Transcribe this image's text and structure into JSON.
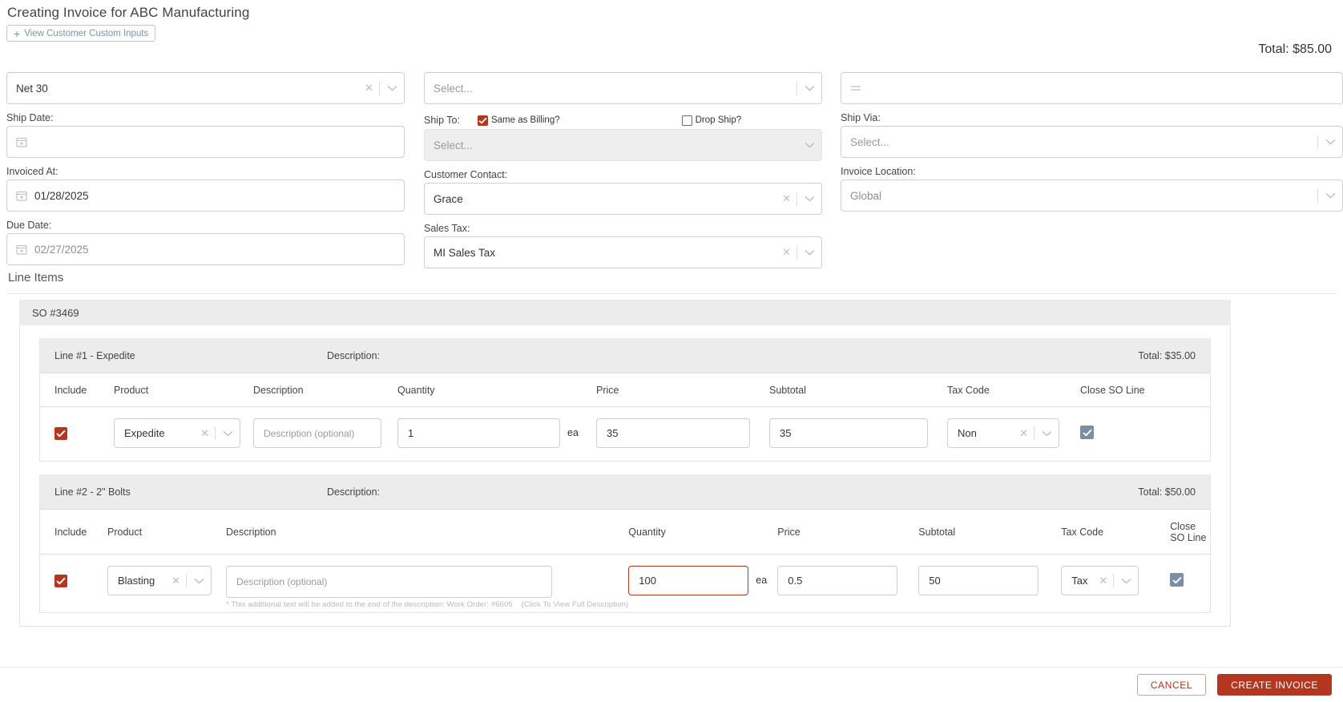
{
  "header": {
    "title": "Creating Invoice for ABC Manufacturing",
    "custom_inputs_button": "View Customer Custom Inputs",
    "plus_icon": "+",
    "total": "Total: $85.00"
  },
  "colors": {
    "accent_red": "#b5361f",
    "checkbox_blue": "#7a8fa6",
    "link_blue": "#7a93ad",
    "header_gray": "#ececec"
  },
  "form": {
    "terms": {
      "value": "Net 30",
      "placeholder": "Select..."
    },
    "ship_date": {
      "label": "Ship Date:",
      "value": "",
      "placeholder": ""
    },
    "invoiced_at": {
      "label": "Invoiced At:",
      "value": "01/28/2025"
    },
    "due_date": {
      "label": "Due Date:",
      "value": "02/27/2025"
    },
    "billing_select": {
      "placeholder": "Select..."
    },
    "ship_to": {
      "label": "Ship To:",
      "same_as_billing_label": "Same as Billing?",
      "same_as_billing_checked": true,
      "drop_ship_label": "Drop Ship?",
      "drop_ship_checked": false,
      "placeholder": "Select..."
    },
    "customer_contact": {
      "label": "Customer Contact:",
      "value": "Grace"
    },
    "sales_tax": {
      "label": "Sales Tax:",
      "value": "MI Sales Tax"
    },
    "notes": {
      "placeholder": ""
    },
    "ship_via": {
      "label": "Ship Via:",
      "placeholder": "Select..."
    },
    "invoice_location": {
      "label": "Invoice Location:",
      "value": "Global"
    }
  },
  "line_items": {
    "section_title": "Line Items",
    "so_label": "SO #3469",
    "columns": [
      "Include",
      "Product",
      "Description",
      "Quantity",
      "Price",
      "Subtotal",
      "Tax Code",
      "Close SO Line"
    ],
    "description_head_label": "Description:",
    "lines": [
      {
        "name": "Line #1 - Expedite",
        "description_label": "Description:",
        "description_value": "",
        "total": "Total: $35.00",
        "include_checked": true,
        "product": "Expedite",
        "description_placeholder": "Description (optional)",
        "description": "",
        "quantity": "1",
        "unit": "ea",
        "price": "35",
        "subtotal": "35",
        "tax_code": "Non",
        "close_so_line_checked": true,
        "quantity_focused": false,
        "note": ""
      },
      {
        "name": "Line #2 - 2\" Bolts",
        "description_label": "Description:",
        "description_value": "",
        "total": "Total: $50.00",
        "include_checked": true,
        "product": "Blasting",
        "description_placeholder": "Description (optional)",
        "description": "",
        "quantity": "100",
        "unit": "ea",
        "price": "0.5",
        "subtotal": "50",
        "tax_code": "Tax",
        "close_so_line_checked": true,
        "quantity_focused": true,
        "note": "* This additional text will be added to the end of the description: Work Order: #6605",
        "note_link": "(Click To View Full Description)"
      }
    ]
  },
  "footer": {
    "cancel_label": "CANCEL",
    "create_label": "CREATE INVOICE"
  }
}
